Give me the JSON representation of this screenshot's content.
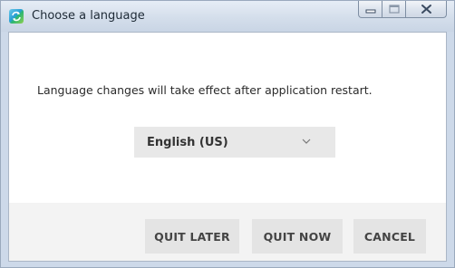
{
  "window": {
    "title": "Choose a language",
    "icon": "app-refresh-icon"
  },
  "dialog": {
    "message": "Language changes will take effect after application restart.",
    "language_select": {
      "selected": "English (US)",
      "chevron_icon": "chevron-down-icon"
    }
  },
  "buttons": {
    "quit_later": "QUIT LATER",
    "quit_now": "QUIT NOW",
    "cancel": "CANCEL"
  },
  "colors": {
    "titlebar": "#d4deeb",
    "button_bg": "#e4e4e4",
    "footer_bg": "#f3f3f3",
    "select_bg": "#e8e8e8"
  }
}
